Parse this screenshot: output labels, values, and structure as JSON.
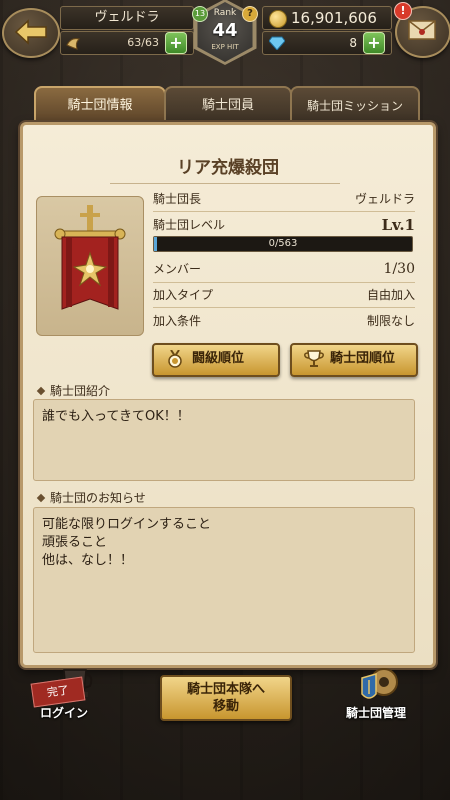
{
  "header": {
    "player_name": "ヴェルドラ",
    "stamina": "63/63",
    "rank_label": "Rank",
    "rank_value": "44",
    "rank_level": "13",
    "rank_exp_label": "EXP HIT",
    "help_icon": "?",
    "gold": "16,901,606",
    "gems": "8",
    "mail_alert": "!"
  },
  "tabs": [
    {
      "label": "騎士団情報",
      "active": true
    },
    {
      "label": "騎士団員",
      "active": false
    },
    {
      "label": "騎士団ミッション",
      "active": false
    }
  ],
  "guild": {
    "name": "リア充爆殺団",
    "leader_label": "騎士団長",
    "leader_value": "ヴェルドラ",
    "level_label": "騎士団レベル",
    "level_value": "Lv.1",
    "exp_text": "0/563",
    "exp_progress": 0.01,
    "members_label": "メンバー",
    "members_value": "1/30",
    "join_type_label": "加入タイプ",
    "join_type_value": "自由加入",
    "join_cond_label": "加入条件",
    "join_cond_value": "制限なし"
  },
  "buttons": {
    "battle_rank": "闘級順位",
    "guild_rank": "騎士団順位"
  },
  "intro": {
    "heading": "騎士団紹介",
    "text": "誰でも入ってきてOK！！"
  },
  "notice": {
    "heading": "騎士団のお知らせ",
    "lines": [
      "可能な限りログインすること",
      "頑張ること",
      "他は、なし！！"
    ]
  },
  "bottom": {
    "login_stamp": "完了",
    "login_label": "ログイン",
    "move_line1": "騎士団本隊へ",
    "move_line2": "移動",
    "manage_label": "騎士団管理"
  },
  "colors": {
    "panel": "#f0e5cc",
    "gold_button": "#e2b65c",
    "exp_fill": "#5aa6d8",
    "banner_red": "#a3221f"
  }
}
